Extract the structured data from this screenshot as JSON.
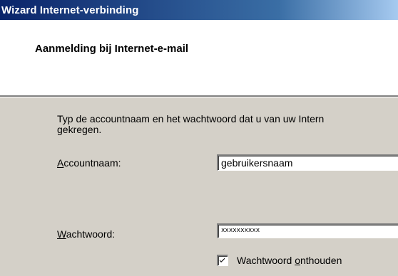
{
  "window": {
    "title": "Wizard Internet-verbinding"
  },
  "header": {
    "title": "Aanmelding bij Internet-e-mail"
  },
  "content": {
    "intro_line1": "Typ de accountnaam en het wachtwoord dat u van uw Intern",
    "intro_line2": "gekregen.",
    "account": {
      "label_accel": "A",
      "label_rest": "ccountnaam:",
      "value": "gebruikersnaam"
    },
    "password": {
      "label_accel": "W",
      "label_rest": "achtwoord:",
      "value": "xxxxxxxxxx"
    },
    "remember": {
      "label_pre": "Wachtwoord ",
      "label_accel": "o",
      "label_post": "nthouden",
      "checked": true
    }
  },
  "colors": {
    "titlebar_start": "#0a246a",
    "titlebar_end": "#a6caf0",
    "dialog_face": "#d4d0c8"
  }
}
